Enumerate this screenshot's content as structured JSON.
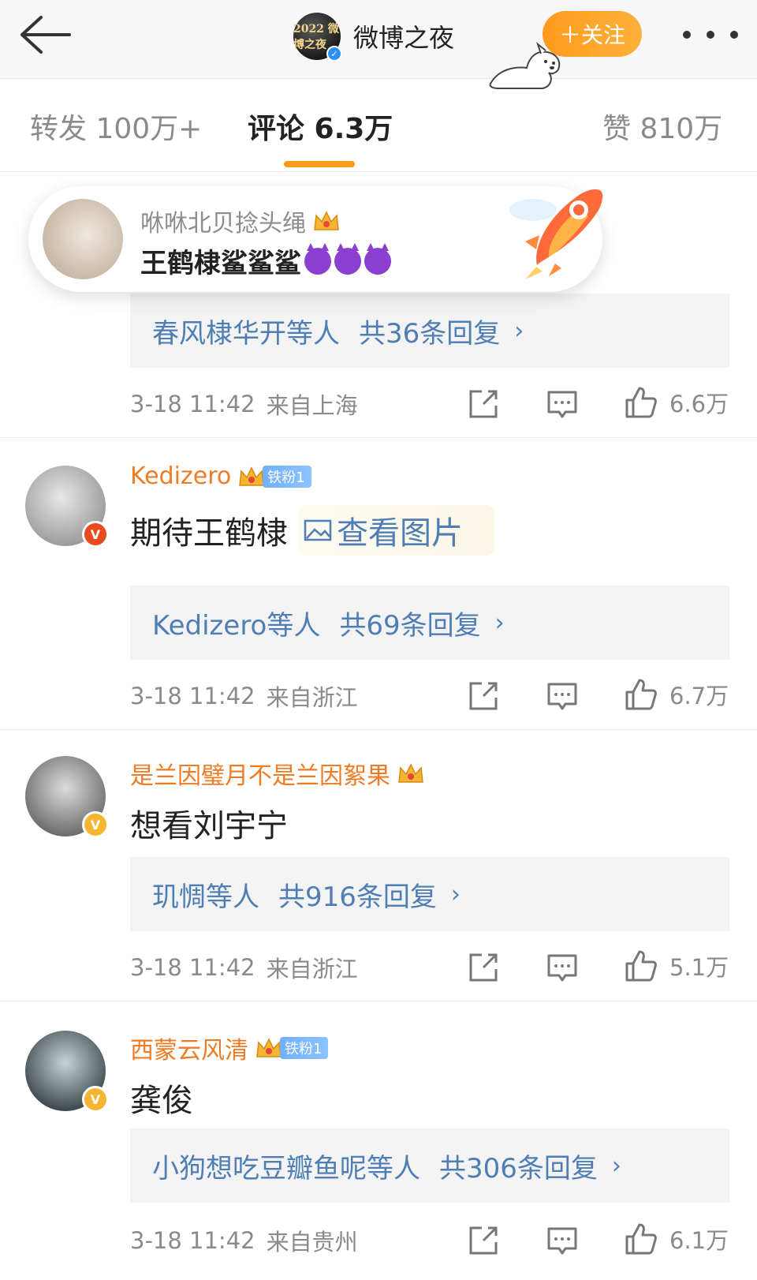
{
  "header": {
    "account_name": "微博之夜",
    "avatar_text": "2022 微博之夜",
    "follow_label": "＋关注"
  },
  "tabs": [
    {
      "label": "转发 100万+"
    },
    {
      "label": "评论 6.3万"
    },
    {
      "label": "赞 810万"
    }
  ],
  "pinned": {
    "user": "咻咻北贝捻头绳",
    "text": "王鹤棣鲨鲨鲨"
  },
  "comments": [
    {
      "replies_by": "春风棣华开等人",
      "reply_count": "共36条回复",
      "time": "3-18 11:42",
      "source": "来自上海",
      "likes": "6.6万"
    },
    {
      "user": "Kedizero",
      "fan_badge": "铁粉1",
      "text": "期待王鹤棣",
      "pic_link": "查看图片",
      "replies_by": "Kedizero等人",
      "reply_count": "共69条回复",
      "time": "3-18 11:42",
      "source": "来自浙江",
      "likes": "6.7万"
    },
    {
      "user": "是兰因璧月不是兰因絮果",
      "text": "想看刘宇宁",
      "replies_by": "玑惆等人",
      "reply_count": "共916条回复",
      "time": "3-18 11:42",
      "source": "来自浙江",
      "likes": "5.1万"
    },
    {
      "user": "西蒙云风清",
      "fan_badge": "铁粉1",
      "text": "龚俊",
      "replies_by": "小狗想吃豆瓣鱼呢等人",
      "reply_count": "共306条回复",
      "time": "3-18 11:42",
      "source": "来自贵州",
      "likes": "6.1万"
    }
  ],
  "colors": {
    "accent": "#ff9a1e",
    "username": "#ef7b24",
    "link": "#4e7eb3",
    "meta": "#8a8a8a"
  }
}
